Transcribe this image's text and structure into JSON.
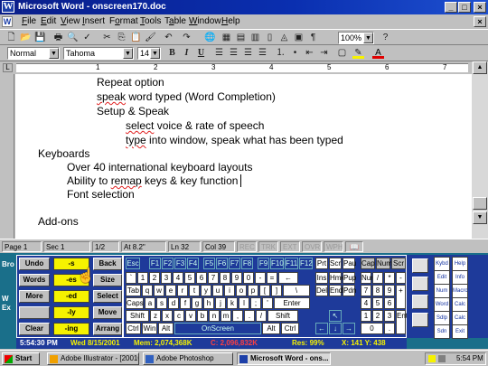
{
  "window": {
    "title": "Microsoft Word - onscreen170.doc",
    "min": "_",
    "max": "□",
    "close": "×"
  },
  "menu": [
    "File",
    "Edit",
    "View",
    "Insert",
    "Format",
    "Tools",
    "Table",
    "Window",
    "Help"
  ],
  "menu_accel": [
    "F",
    "E",
    "V",
    "I",
    "o",
    "T",
    "a",
    "W",
    "H"
  ],
  "docclose": "×",
  "toolbar": {
    "zoom": "100%",
    "style": "Normal",
    "font": "Tahoma",
    "size": "14",
    "bold": "B",
    "italic": "I",
    "underline": "U"
  },
  "ruler": [
    "1",
    "2",
    "3",
    "4",
    "5",
    "6",
    "7"
  ],
  "document": {
    "lines": [
      {
        "text": "Repeat option",
        "indent": 2
      },
      {
        "text": "speak word typed (Word Completion)",
        "indent": 2
      },
      {
        "text": "Setup & Speak",
        "indent": 2
      },
      {
        "text": "select voice & rate of speech",
        "indent": 3
      },
      {
        "text": "type into window, speak what has been typed",
        "indent": 3
      },
      {
        "text": "Keyboards",
        "indent": 0
      },
      {
        "text": "Over 40 international keyboard layouts",
        "indent": 1
      },
      {
        "text": "Ability to remap keys & key function",
        "indent": 1
      },
      {
        "text": "Font selection",
        "indent": 1
      },
      {
        "text": "",
        "indent": 0
      },
      {
        "text": "Add-ons",
        "indent": 0
      }
    ]
  },
  "status": {
    "page": "Page 1",
    "sec": "Sec 1",
    "pages": "1/2",
    "at": "At 8.2\"",
    "ln": "Ln 32",
    "col": "Col 39",
    "rec": "REC",
    "trk": "TRK",
    "ext": "EXT",
    "ovr": "OVR",
    "wph": "WPH"
  },
  "wordpanel": {
    "rows": [
      [
        "Undo",
        "-s",
        "Back"
      ],
      [
        "Words",
        "-es",
        "Size"
      ],
      [
        "More",
        "-ed",
        "Select"
      ],
      [
        "",
        "-ly",
        "Move"
      ],
      [
        "Clear",
        "-ing",
        "Arrang"
      ]
    ]
  },
  "keyboard": {
    "fn_row": [
      "Esc",
      "F1",
      "F2",
      "F3",
      "F4",
      "F5",
      "F6",
      "F7",
      "F8",
      "F9",
      "F10",
      "F11",
      "F12",
      "Prt",
      "Scr",
      "Pau",
      "Cap",
      "Num",
      "Scr"
    ],
    "num_row": [
      "`",
      "1",
      "2",
      "3",
      "4",
      "5",
      "6",
      "7",
      "8",
      "9",
      "0",
      "-",
      "=",
      "←",
      "Ins",
      "Hme",
      "Pup",
      "Num",
      "/",
      "*",
      "-"
    ],
    "q_row": [
      "Tab",
      "q",
      "w",
      "e",
      "r",
      "t",
      "y",
      "u",
      "i",
      "o",
      "p",
      "[",
      "]",
      "\\",
      "Del",
      "End",
      "Pdn",
      "7",
      "8",
      "9",
      "+"
    ],
    "a_row": [
      "Caps",
      "a",
      "s",
      "d",
      "f",
      "g",
      "h",
      "j",
      "k",
      "l",
      ";",
      "'",
      "Enter",
      "4",
      "5",
      "6"
    ],
    "z_row": [
      "Shift",
      "z",
      "x",
      "c",
      "v",
      "b",
      "n",
      "m",
      ",",
      ".",
      "/",
      "Shift",
      "↖",
      "1",
      "2",
      "3",
      "Ent"
    ],
    "bot_row": [
      "Ctrl",
      "Win",
      "Alt",
      "OnScreen",
      "Alt",
      "Ctrl",
      "←",
      "↓",
      "→",
      "0",
      "."
    ]
  },
  "rightpanel": [
    "Kybd",
    "Help",
    "Edit",
    "Info",
    "Num",
    "Macro",
    "Word",
    "Calc",
    "Sdlp",
    "Calc",
    "Sdn",
    "Exit"
  ],
  "infobar": {
    "time": "5:54:30 PM",
    "date": "Wed 8/15/2001",
    "mem": "Mem: 2,074,368K",
    "c": "C: 2,096,832K",
    "res": "Res: 99%",
    "xy": "X: 141 Y: 438"
  },
  "desktop": {
    "label1": "Bro",
    "label2": "W",
    "label3": "Ex"
  },
  "taskbar": {
    "start": "Start",
    "tasks": [
      "Adobe Illustrator - [200103...",
      "Adobe Photoshop",
      "Microsoft Word - ons..."
    ],
    "clock": "5:54 PM"
  },
  "colors": {
    "titlebar": "#0a1e8a",
    "accent_yellow": "#f6f200",
    "panel_blue": "#1e3a9a",
    "info_blue": "#1e3a9a"
  }
}
